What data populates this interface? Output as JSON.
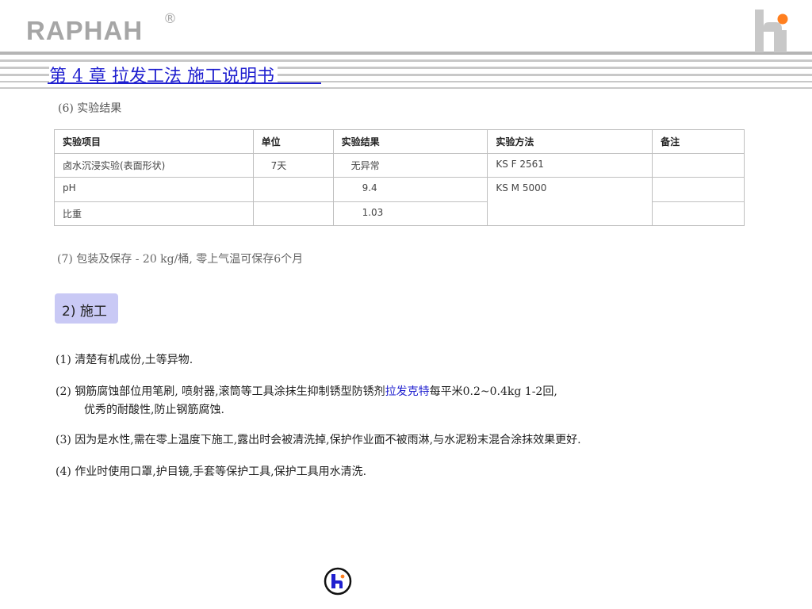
{
  "header": {
    "brand": "RAPHAH",
    "registered_mark": "®",
    "chapter_title": "第 4 章  拉发工法 施工说明书"
  },
  "section6": {
    "label": "(6) 实验结果",
    "table": {
      "columns": [
        "实验项目",
        "单位",
        "实验结果",
        "实验方法",
        "备注"
      ],
      "rows": [
        [
          "卤水沉浸实验(表面形状)",
          "7天",
          "无异常",
          "KS F 2561",
          ""
        ],
        [
          "pH",
          "",
          "9.4",
          "KS M 5000",
          ""
        ],
        [
          "比重",
          "",
          "1.03",
          "",
          ""
        ]
      ]
    }
  },
  "section7": {
    "text": "(7) 包装及保存 - 20 kg/桶, 零上气温可保存6个月"
  },
  "construction": {
    "heading": "2) 施工",
    "steps": {
      "s1": "(1) 清楚有机成份,土等异物.",
      "s2_before": "(2) 钢筋腐蚀部位用笔刷, 喷射器,滚筒等工具涂抹生抑制锈型防锈剂",
      "s2_highlight": "拉发克特",
      "s2_after": "每平米0.2~0.4kg 1-2回,",
      "s2_line2": "优秀的耐酸性,防止钢筋腐蚀.",
      "s3": "(3) 因为是水性,需在零上温度下施工,露出时会被清洗掉,保护作业面不被雨淋,与水泥粉末混合涂抹效果更好.",
      "s4": "(4) 作业时使用口罩,护目镜,手套等保护工具,保护工具用水清洗."
    }
  },
  "icons": {
    "corner_logo": "hi-logo-icon",
    "footer_logo": "hi-circle-logo-icon"
  },
  "colors": {
    "title_blue": "#1f1fcf",
    "accent_orange": "#ff7f1f",
    "brand_gray": "#a6a6a6",
    "heading_bg": "#c9c9f5"
  }
}
